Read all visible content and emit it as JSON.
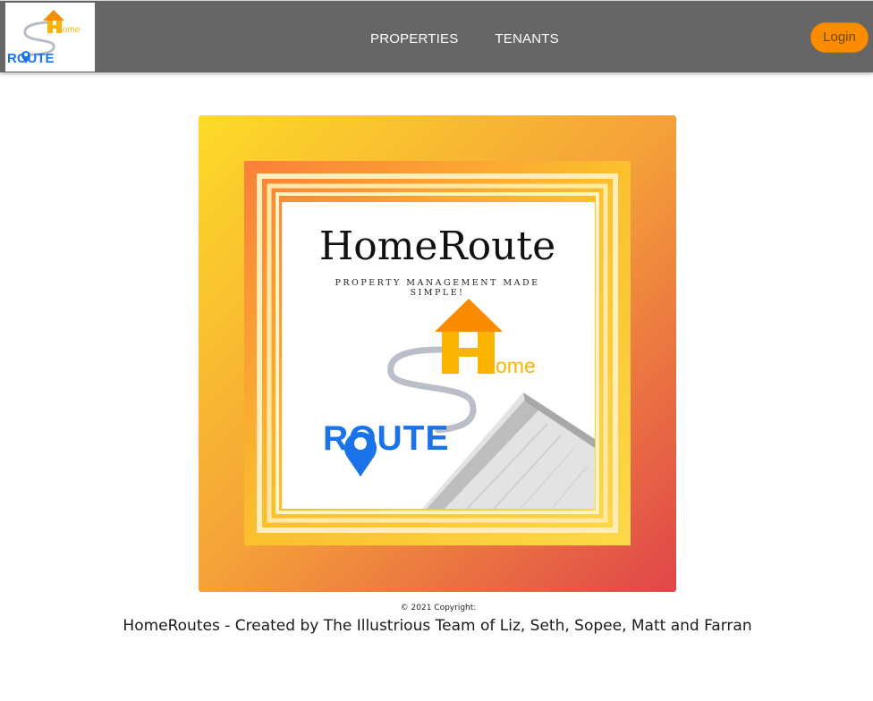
{
  "navbar": {
    "logo": {
      "icon": "homeroute-logo-icon",
      "top_text": "ome",
      "bottom_text": "ROUTE"
    },
    "links": [
      {
        "label": "PROPERTIES"
      },
      {
        "label": "TENANTS"
      }
    ],
    "login_label": "Login",
    "colors": {
      "bar": "#666666",
      "login": "#fb8c00"
    }
  },
  "hero": {
    "title": "HomeRoute",
    "tagline_line1": "PROPERTY MANAGEMENT MADE",
    "tagline_line2": "SIMPLE!",
    "logo_top_text": "ome",
    "logo_bottom_text": "ROUTE",
    "colors": {
      "gradient_start": "#fddb28",
      "gradient_end": "#e0454a",
      "house": "#fb8c00",
      "route": "#1a73e8"
    }
  },
  "footer": {
    "copyright": "© 2021 Copyright:",
    "credits": "HomeRoutes - Created by The Illustrious Team of Liz, Seth, Sopee, Matt and Farran"
  }
}
